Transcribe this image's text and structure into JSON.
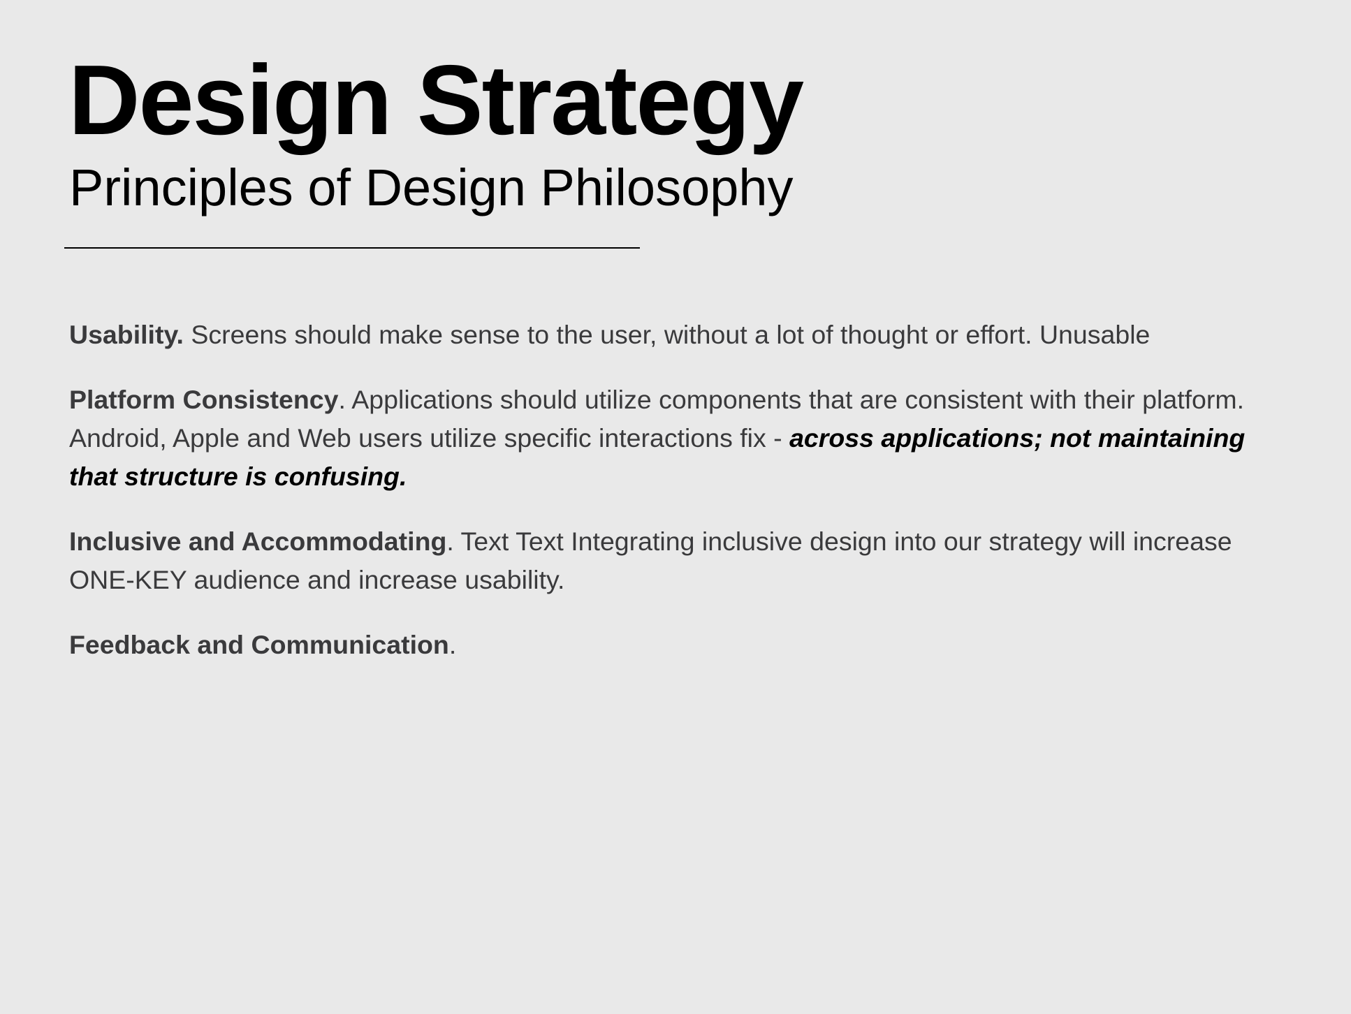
{
  "slide": {
    "title": "Design Strategy",
    "subtitle": "Principles of Design Philosophy",
    "paragraphs": [
      {
        "term": "Usability.",
        "text": " Screens should make sense to the user, without a lot of thought or effort. Unusable"
      },
      {
        "term": "Platform Consistency",
        "text": ". Applications should utilize components that are consistent with their platform. Android, Apple and Web users utilize specific interactions fix - ",
        "emphasis": "across applications; not maintaining that structure is confusing."
      },
      {
        "term": "Inclusive and Accommodating",
        "text": ". Text Text Integrating inclusive design into our strategy will increase ONE-KEY audience and increase usability."
      },
      {
        "term": "Feedback and Communication",
        "text": "."
      }
    ]
  },
  "colors": {
    "background": "#e9e9e9",
    "heading": "#000000",
    "body_text": "#3a3a3c"
  }
}
